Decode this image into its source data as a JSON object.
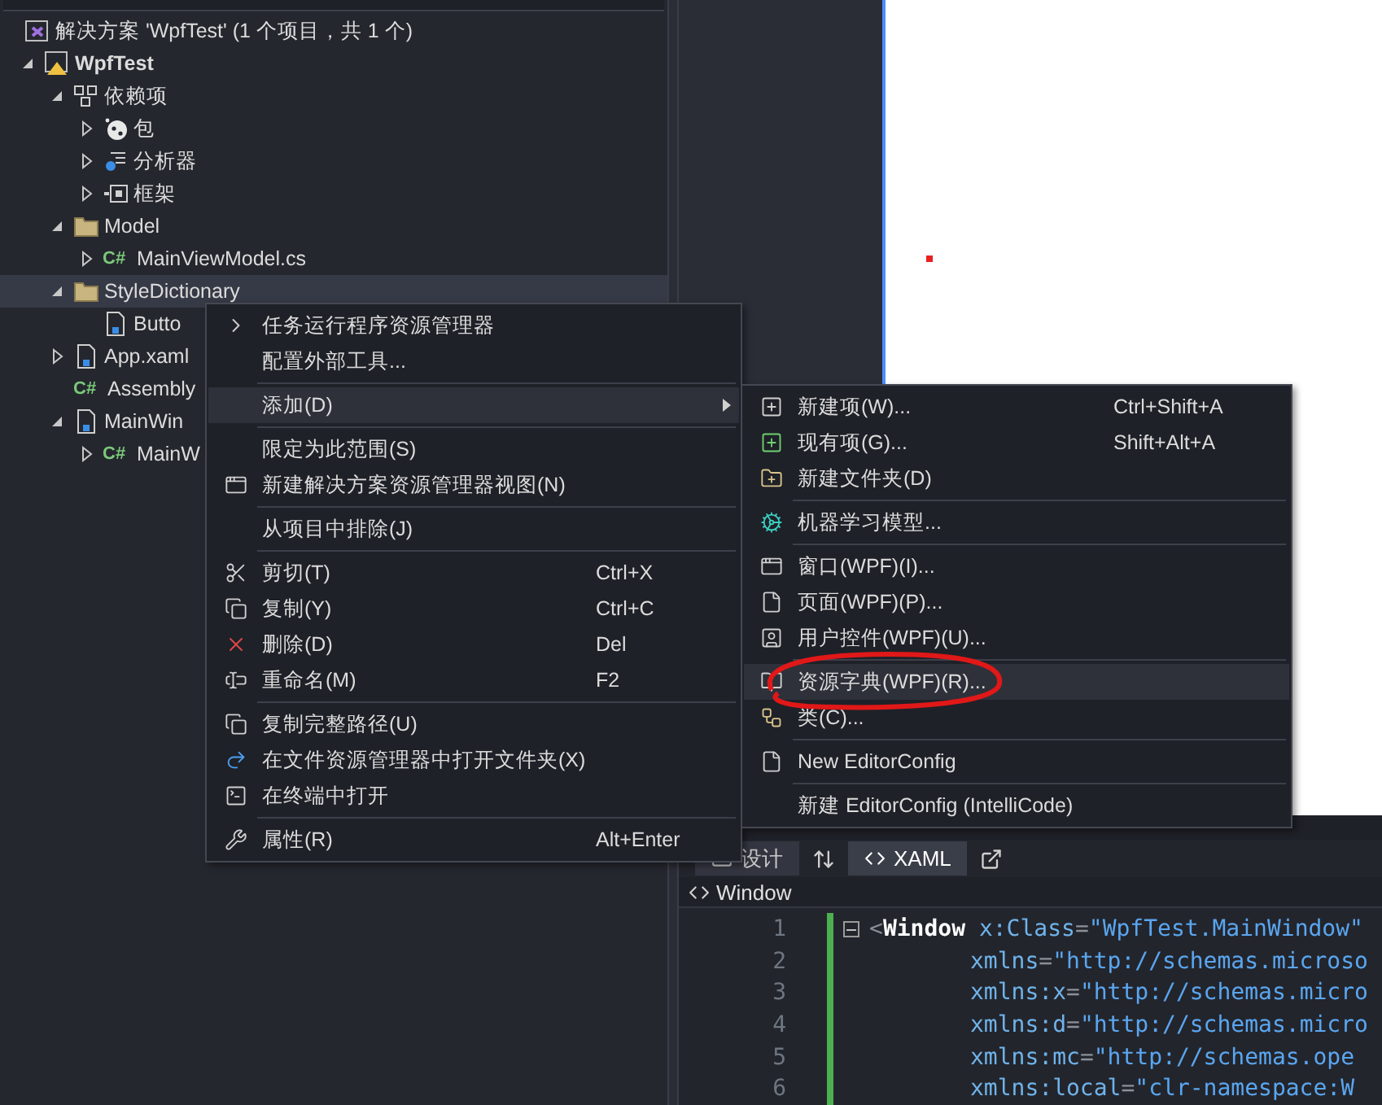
{
  "explorer": {
    "tree": [
      {
        "label": "解决方案 'WpfTest' (1 个项目，共 1 个)",
        "kind": "solution",
        "selected": false,
        "children": [
          {
            "label": "WpfTest",
            "kind": "project",
            "expanded": true,
            "selected": false,
            "children": [
              {
                "label": "依赖项",
                "kind": "dependencies",
                "expanded": true,
                "selected": false,
                "children": [
                  {
                    "label": "包",
                    "kind": "package",
                    "expanded": false,
                    "selected": false
                  },
                  {
                    "label": "分析器",
                    "kind": "analyzer",
                    "expanded": false,
                    "selected": false
                  },
                  {
                    "label": "框架",
                    "kind": "framework",
                    "expanded": false,
                    "selected": false
                  }
                ]
              },
              {
                "label": "Model",
                "kind": "folder",
                "expanded": true,
                "selected": false,
                "children": [
                  {
                    "label": "MainViewModel.cs",
                    "kind": "csharp",
                    "badge": "C#",
                    "expanded": false,
                    "selected": false
                  }
                ]
              },
              {
                "label": "StyleDictionary",
                "kind": "folder",
                "expanded": true,
                "selected": true,
                "children": [
                  {
                    "label": "Butto",
                    "kind": "xaml",
                    "selected": false
                  }
                ]
              },
              {
                "label": "App.xaml",
                "kind": "xaml",
                "expanded": false,
                "selected": false
              },
              {
                "label": "Assembly",
                "kind": "csharp",
                "badge": "C#",
                "selected": false
              },
              {
                "label": "MainWin",
                "kind": "xaml",
                "expanded": true,
                "selected": false,
                "children": [
                  {
                    "label": "MainW",
                    "kind": "csharp",
                    "badge": "C#",
                    "expanded": false,
                    "selected": false
                  }
                ]
              }
            ]
          }
        ]
      }
    ]
  },
  "context_menu": [
    {
      "kind": "item",
      "label": "任务运行程序资源管理器",
      "selected": false
    },
    {
      "kind": "item",
      "label": "配置外部工具...",
      "selected": false
    },
    {
      "kind": "separator"
    },
    {
      "kind": "item",
      "label": "添加(D)",
      "selected": true,
      "submenu": true
    },
    {
      "kind": "separator"
    },
    {
      "kind": "item",
      "label": "限定为此范围(S)",
      "selected": false
    },
    {
      "kind": "item",
      "label": "新建解决方案资源管理器视图(N)",
      "selected": false
    },
    {
      "kind": "separator"
    },
    {
      "kind": "item",
      "label": "从项目中排除(J)",
      "selected": false
    },
    {
      "kind": "separator"
    },
    {
      "kind": "item",
      "label": "剪切(T)",
      "shortcut": "Ctrl+X",
      "selected": false
    },
    {
      "kind": "item",
      "label": "复制(Y)",
      "shortcut": "Ctrl+C",
      "selected": false
    },
    {
      "kind": "item",
      "label": "删除(D)",
      "shortcut": "Del",
      "selected": false
    },
    {
      "kind": "item",
      "label": "重命名(M)",
      "shortcut": "F2",
      "selected": false
    },
    {
      "kind": "separator"
    },
    {
      "kind": "item",
      "label": "复制完整路径(U)",
      "selected": false
    },
    {
      "kind": "item",
      "label": "在文件资源管理器中打开文件夹(X)",
      "selected": false
    },
    {
      "kind": "item",
      "label": "在终端中打开",
      "selected": false
    },
    {
      "kind": "separator"
    },
    {
      "kind": "item",
      "label": "属性(R)",
      "shortcut": "Alt+Enter",
      "selected": false
    }
  ],
  "submenu": [
    {
      "kind": "item",
      "label": "新建项(W)...",
      "shortcut": "Ctrl+Shift+A",
      "selected": false
    },
    {
      "kind": "item",
      "label": "现有项(G)...",
      "shortcut": "Shift+Alt+A",
      "selected": false
    },
    {
      "kind": "item",
      "label": "新建文件夹(D)",
      "selected": false
    },
    {
      "kind": "separator"
    },
    {
      "kind": "item",
      "label": "机器学习模型...",
      "selected": false
    },
    {
      "kind": "separator"
    },
    {
      "kind": "item",
      "label": "窗口(WPF)(I)...",
      "selected": false
    },
    {
      "kind": "item",
      "label": "页面(WPF)(P)...",
      "selected": false
    },
    {
      "kind": "item",
      "label": "用户控件(WPF)(U)...",
      "selected": false
    },
    {
      "kind": "separator"
    },
    {
      "kind": "item",
      "label": "资源字典(WPF)(R)...",
      "selected": true
    },
    {
      "kind": "item",
      "label": "类(C)...",
      "selected": false
    },
    {
      "kind": "separator"
    },
    {
      "kind": "item",
      "label": "New EditorConfig",
      "selected": false
    },
    {
      "kind": "separator"
    },
    {
      "kind": "item",
      "label": "新建 EditorConfig (IntelliCode)",
      "selected": false
    }
  ],
  "editor": {
    "tabs": [
      {
        "label": "设计",
        "selected": false
      },
      {
        "label": "XAML",
        "selected": true
      }
    ],
    "breadcrumb": "Window",
    "lines": [
      {
        "number": "1",
        "kind": "start",
        "tokens": [
          {
            "kind": "punct",
            "text": "<"
          },
          {
            "kind": "tag",
            "text": "Window"
          },
          {
            "kind": "attr",
            "text": "x:Class"
          },
          {
            "kind": "punct",
            "text": "="
          },
          {
            "kind": "value",
            "text": "\"WpfTest.MainWindow\""
          }
        ]
      },
      {
        "number": "2",
        "kind": "continuation",
        "tokens": [
          {
            "kind": "attr",
            "text": "xmlns"
          },
          {
            "kind": "punct",
            "text": "="
          },
          {
            "kind": "value",
            "text": "\"http://schemas.microso"
          }
        ]
      },
      {
        "number": "3",
        "kind": "continuation",
        "tokens": [
          {
            "kind": "attr",
            "text": "xmlns:x"
          },
          {
            "kind": "punct",
            "text": "="
          },
          {
            "kind": "value",
            "text": "\"http://schemas.micro"
          }
        ]
      },
      {
        "number": "4",
        "kind": "continuation",
        "tokens": [
          {
            "kind": "attr",
            "text": "xmlns:d"
          },
          {
            "kind": "punct",
            "text": "="
          },
          {
            "kind": "value",
            "text": "\"http://schemas.micro"
          }
        ]
      },
      {
        "number": "5",
        "kind": "continuation",
        "tokens": [
          {
            "kind": "attr",
            "text": "xmlns:mc"
          },
          {
            "kind": "punct",
            "text": "="
          },
          {
            "kind": "value",
            "text": "\"http://schemas.ope"
          }
        ]
      },
      {
        "number": "6",
        "kind": "continuation",
        "tokens": [
          {
            "kind": "attr",
            "text": "xmlns:local"
          },
          {
            "kind": "punct",
            "text": "="
          },
          {
            "kind": "value",
            "text": "\"clr-namespace:W"
          }
        ]
      }
    ]
  }
}
